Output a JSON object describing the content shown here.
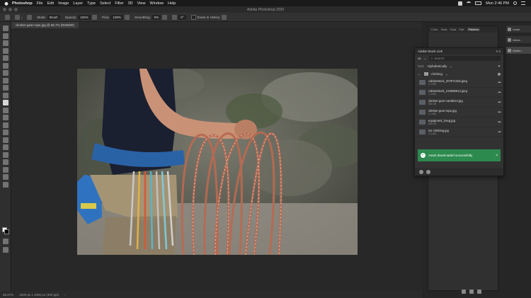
{
  "menubar": {
    "app": "Photoshop",
    "items": [
      "File",
      "Edit",
      "Image",
      "Layer",
      "Type",
      "Select",
      "Filter",
      "3D",
      "View",
      "Window",
      "Help"
    ],
    "clock": "Mon 2:46 PM"
  },
  "window": {
    "title": "Adobe Photoshop 2020"
  },
  "options_bar": {
    "mode_label": "Mode:",
    "mode_value": "Brush",
    "opacity_label": "Opacity:",
    "opacity_value": "100%",
    "flow_label": "Flow:",
    "flow_value": "100%",
    "smoothing_label": "Smoothing:",
    "smoothing_value": "0%",
    "angle_value": "0°",
    "erase_label": "Erase to History"
  },
  "document": {
    "tab_label": "climber-gear-rope.jpg @ 66.7% (RGB/8#)",
    "zoom": "66.67%",
    "info": "1500 px x 1000 px (300 ppi)"
  },
  "collapsed_panel": {
    "tabs": [
      "Color",
      "Swat",
      "Grad",
      "Patt",
      "Patterns"
    ],
    "active": "Patterns"
  },
  "side_buttons": [
    "Learn",
    "Librar...",
    "Adobe..."
  ],
  "asset_link": {
    "title": "Adobe Stock Link",
    "search_placeholder": "Search",
    "all_label": "All",
    "sort_label": "Sort:",
    "sort_value": "Alphabetically",
    "folder_label": "climbing",
    "items": [
      {
        "name": "AdobeStock_207671252.jpeg",
        "size": "1.2 MB"
      },
      {
        "name": "AdobeStock_215985912.jpeg",
        "size": "1.4 MB"
      },
      {
        "name": "climber-gear-carabiner.jpg",
        "size": "980 KB"
      },
      {
        "name": "climber-gear-rope.jpg",
        "size": "1.1 MB"
      },
      {
        "name": "equipment_hang.jpg",
        "size": "860 KB"
      },
      {
        "name": "ice-climbing.jpg",
        "size": "1.3 MB"
      }
    ]
  },
  "toast": {
    "message": "Asset downloaded successfully"
  },
  "colors": {
    "toast_green": "#2d8a4e",
    "panel_bg": "#323232",
    "canvas_bg": "#282828"
  }
}
